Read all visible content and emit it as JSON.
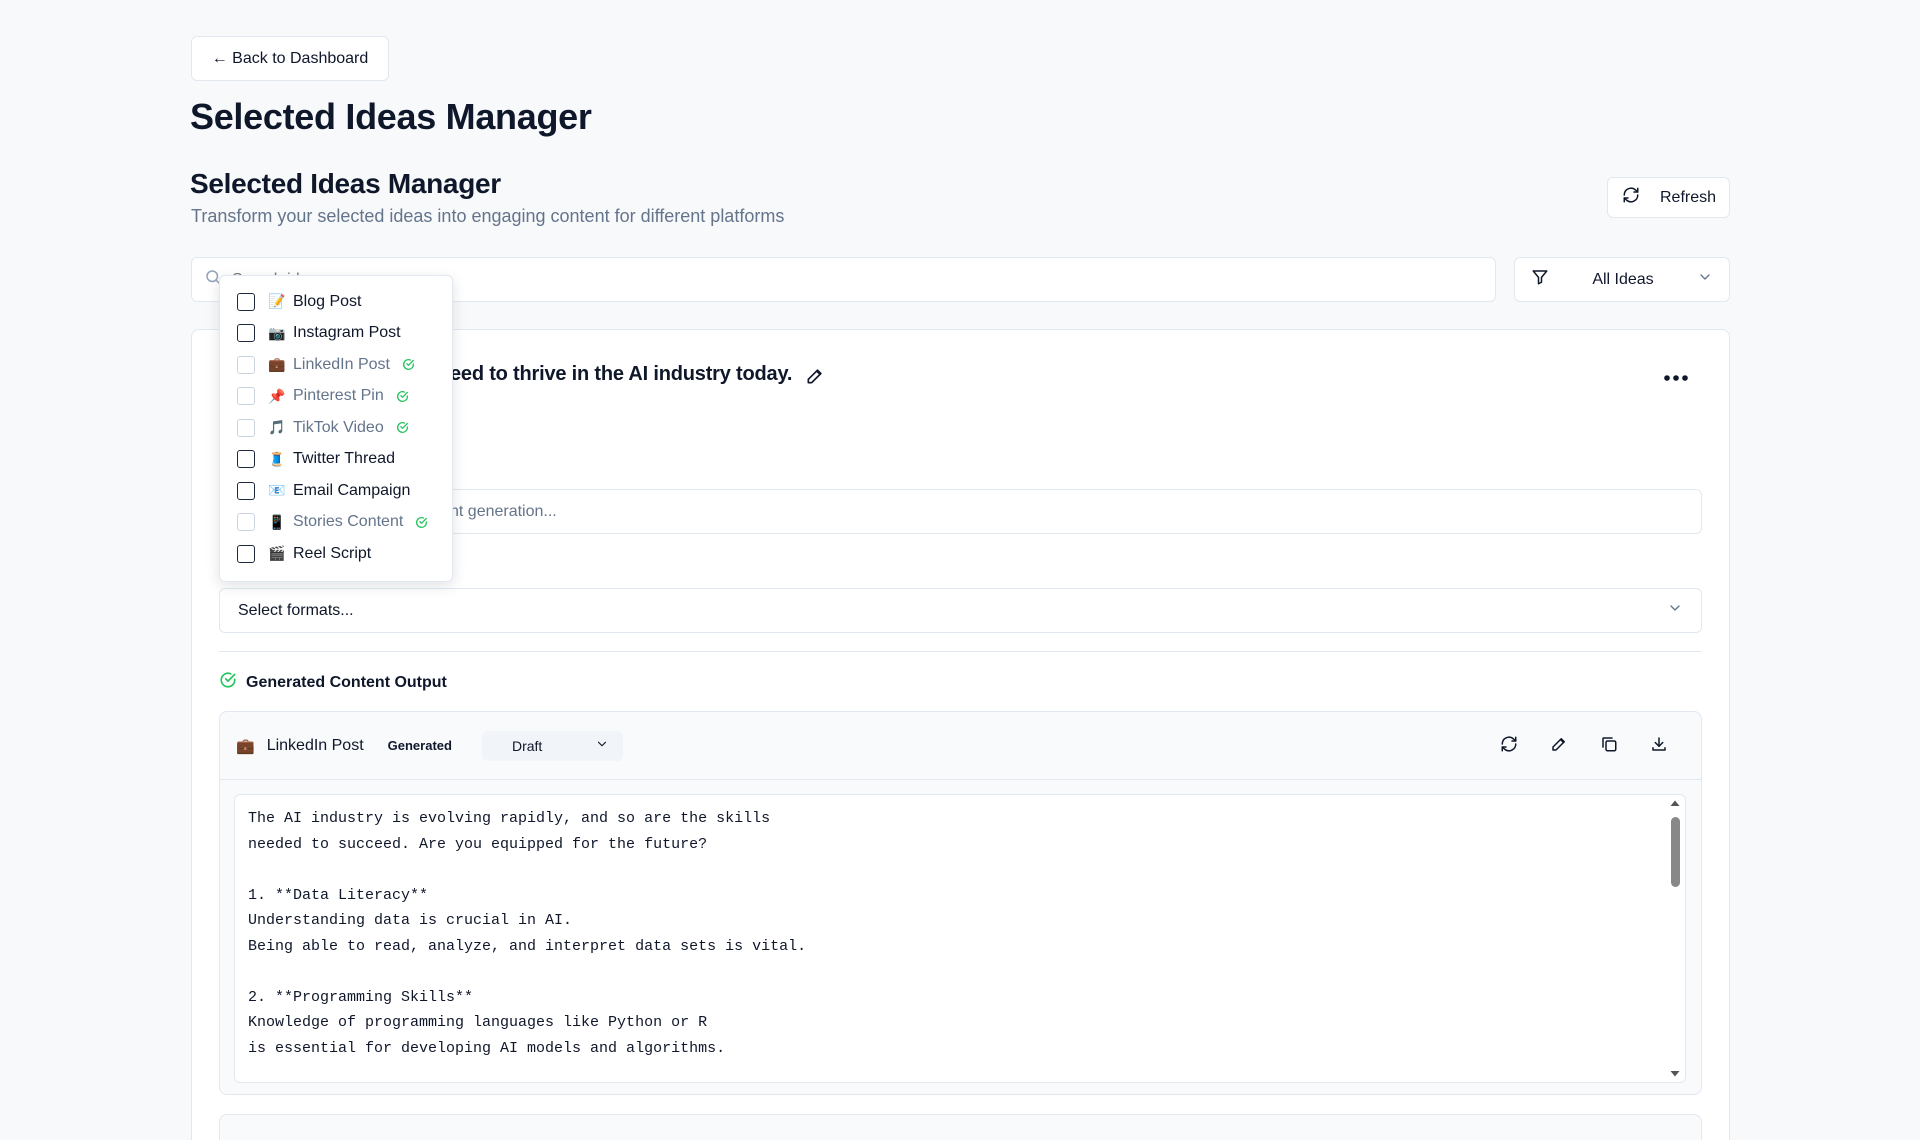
{
  "nav": {
    "back_label": "← Back to Dashboard"
  },
  "page": {
    "title": "Selected Ideas Manager"
  },
  "section": {
    "title": "Selected Ideas Manager",
    "subtitle": "Transform your selected ideas into engaging content for different platforms",
    "refresh_label": "Refresh"
  },
  "search": {
    "placeholder": "Search ideas..."
  },
  "filter": {
    "selected": "All Ideas"
  },
  "idea": {
    "title_visible": "eed to thrive in the AI industry today.",
    "prompt_visible": "nt generation...",
    "formats_placeholder": "Select formats..."
  },
  "output": {
    "header": "Generated Content Output",
    "items": [
      {
        "icon": "💼",
        "name": "LinkedIn Post",
        "badge": "Generated",
        "status": "Draft",
        "content": "The AI industry is evolving rapidly, and so are the skills\nneeded to succeed. Are you equipped for the future?\n\n1. **Data Literacy**\nUnderstanding data is crucial in AI.\nBeing able to read, analyze, and interpret data sets is vital.\n\n2. **Programming Skills**\nKnowledge of programming languages like Python or R\nis essential for developing AI models and algorithms."
      }
    ]
  },
  "formats_dropdown": [
    {
      "icon": "📝",
      "label": "Blog Post",
      "disabled": false,
      "generated": false
    },
    {
      "icon": "📷",
      "label": "Instagram Post",
      "disabled": false,
      "generated": false
    },
    {
      "icon": "💼",
      "label": "LinkedIn Post",
      "disabled": true,
      "generated": true
    },
    {
      "icon": "📌",
      "label": "Pinterest Pin",
      "disabled": true,
      "generated": true
    },
    {
      "icon": "🎵",
      "label": "TikTok Video",
      "disabled": true,
      "generated": true
    },
    {
      "icon": "🧵",
      "label": "Twitter Thread",
      "disabled": false,
      "generated": false
    },
    {
      "icon": "📧",
      "label": "Email Campaign",
      "disabled": false,
      "generated": false
    },
    {
      "icon": "📱",
      "label": "Stories Content",
      "disabled": true,
      "generated": true
    },
    {
      "icon": "🎬",
      "label": "Reel Script",
      "disabled": false,
      "generated": false
    }
  ],
  "colors": {
    "success": "#22c55e",
    "muted": "#64748b",
    "border": "#e2e8f0"
  }
}
